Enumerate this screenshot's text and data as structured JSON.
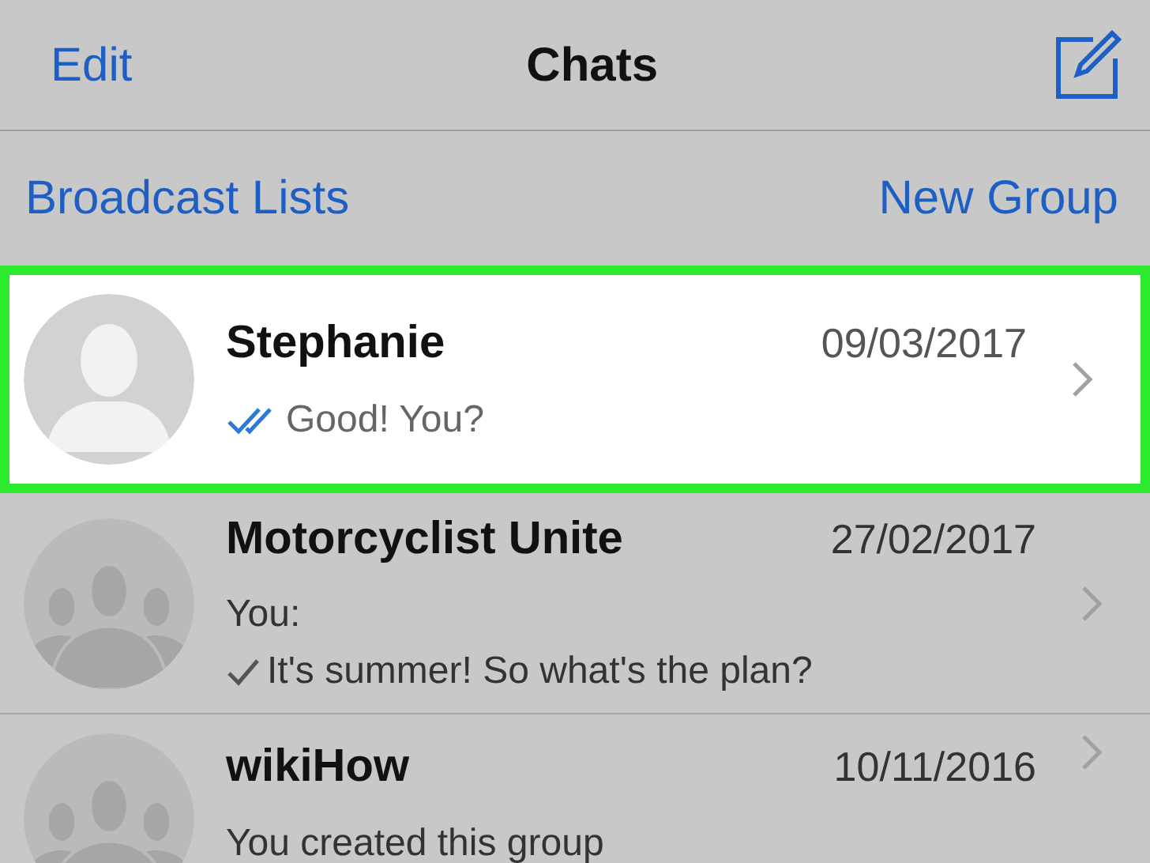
{
  "nav": {
    "left": "Edit",
    "title": "Chats"
  },
  "actions": [
    "Broadcast Lists",
    "New Group"
  ],
  "chats": [
    {
      "name": "Stephanie",
      "date": "09/03/2017",
      "kind": "person",
      "selected": true,
      "lines": [
        {
          "text": "Good! You?",
          "kind": "read"
        }
      ]
    },
    {
      "name": "Motorcyclist Unite",
      "date": "27/02/2017",
      "kind": "group",
      "selected": false,
      "lines": [
        {
          "text": "You:",
          "kind": "plain"
        },
        {
          "text": "It's summer! So what's the plan?",
          "kind": "sent"
        }
      ]
    },
    {
      "name": "wikiHow",
      "date": "10/11/2016",
      "kind": "group",
      "selected": false,
      "lines": [
        {
          "text": "You created this group",
          "kind": "plain"
        }
      ]
    }
  ]
}
